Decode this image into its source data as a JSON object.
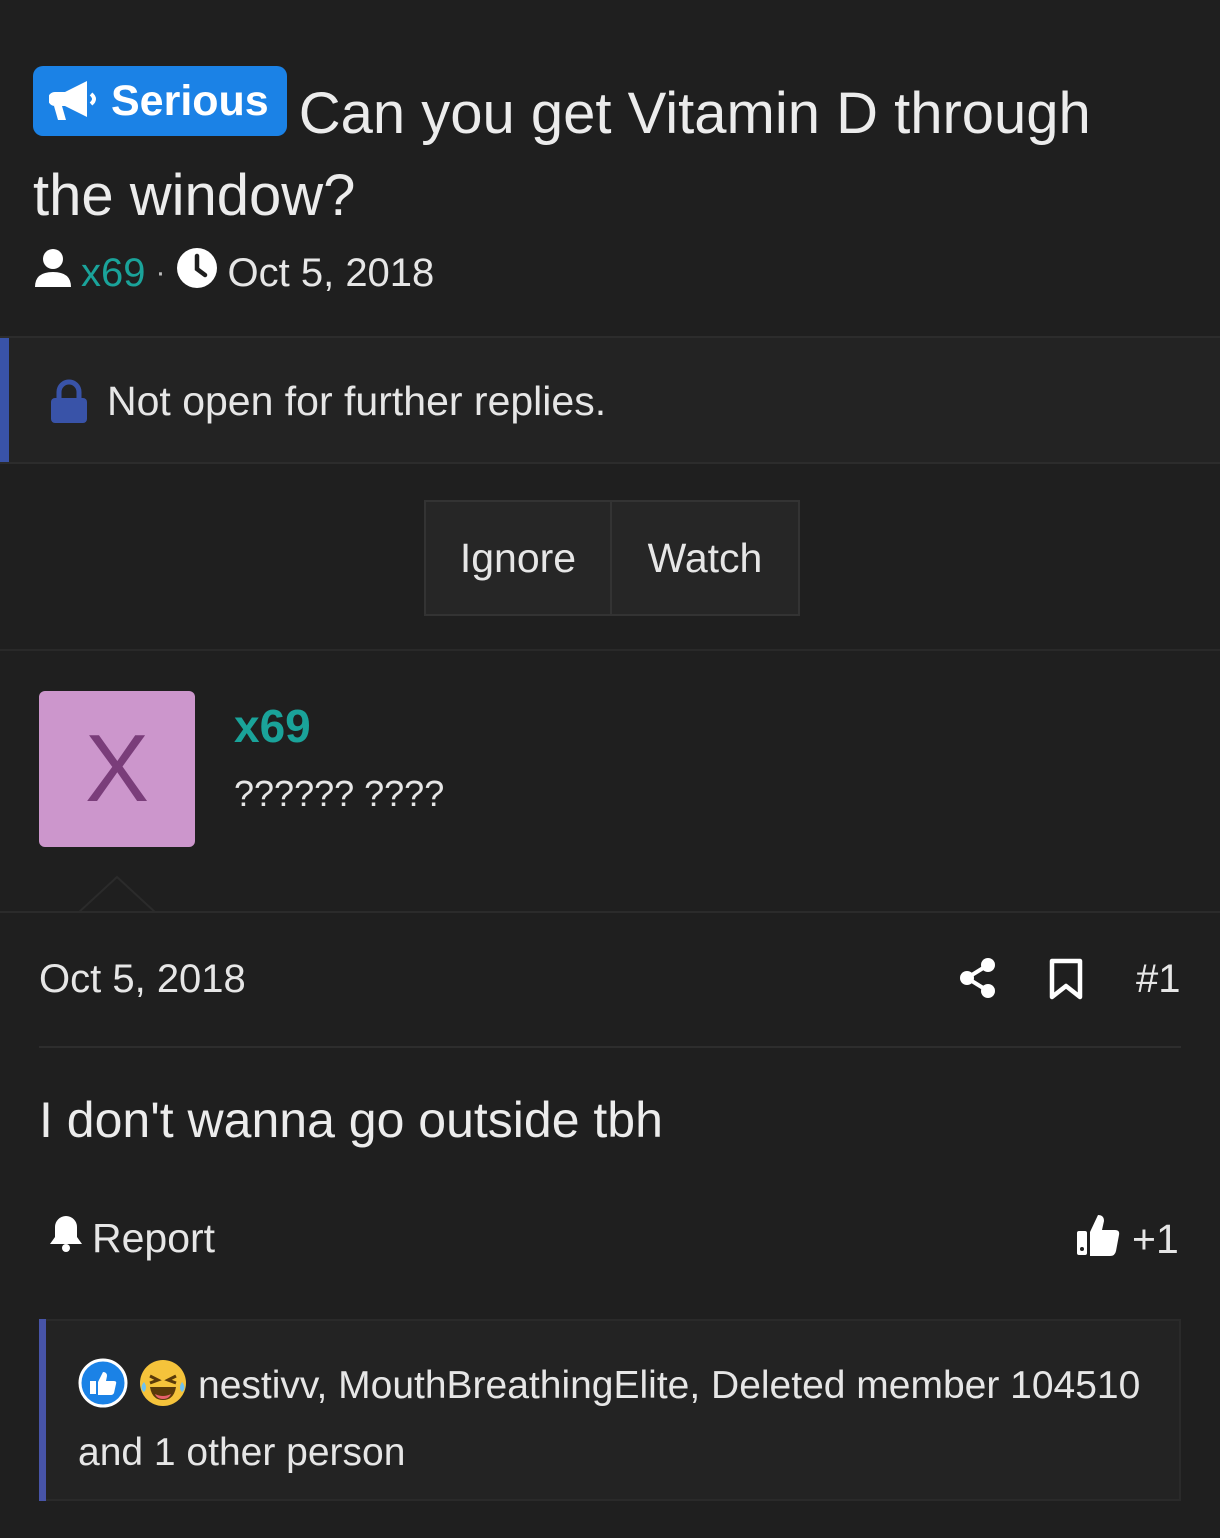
{
  "thread": {
    "prefix": "Serious",
    "title": "Can you get Vitamin D through the window?",
    "author": "x69",
    "separator": "·",
    "date": "Oct 5, 2018"
  },
  "notice": {
    "locked_text": "Not open for further replies."
  },
  "actions": {
    "ignore_label": "Ignore",
    "watch_label": "Watch"
  },
  "post": {
    "avatar_letter": "X",
    "username": "x69",
    "user_title": "?????? ????",
    "date": "Oct 5, 2018",
    "number": "#1",
    "message": "I don't wanna go outside tbh",
    "report_label": "Report",
    "like_count": "+1",
    "reactions_summary": "nestivv, MouthBreathingElite, Deleted member 104510 and 1 other person"
  },
  "icons": {
    "prefix": "megaphone-icon",
    "author": "user-icon",
    "date": "clock-icon",
    "lock": "lock-icon",
    "share": "share-icon",
    "bookmark": "bookmark-icon",
    "report": "bell-icon",
    "like": "thumbs-up-icon",
    "reaction_like": "like-reaction-icon",
    "reaction_laugh": "laugh-reaction-icon"
  },
  "colors": {
    "background": "#1f1f1f",
    "accent_blue": "#1b82e6",
    "username_teal": "#1aa39a",
    "lock_blue": "#3953a8",
    "avatar_bg": "#cc96cc",
    "avatar_letter": "#7a3d7a"
  }
}
